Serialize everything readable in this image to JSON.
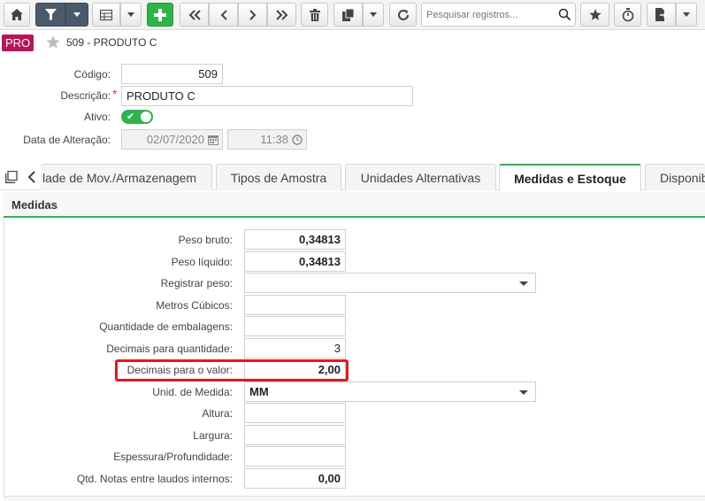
{
  "toolbar": {
    "search_placeholder": "Pesquisar registros..."
  },
  "record": {
    "badge": "PRO",
    "title": "509 - PRODUTO C"
  },
  "form": {
    "codigo_label": "Código:",
    "codigo_value": "509",
    "descricao_label": "Descrição:",
    "descricao_value": "PRODUTO C",
    "ativo_label": "Ativo:",
    "ativo_value": "✔",
    "data_label": "Data de Alteração:",
    "data_value": "02/07/2020",
    "hora_value": "11:38"
  },
  "tabs": [
    {
      "label": "lade de Mov./Armazenagem"
    },
    {
      "label": "Tipos de Amostra"
    },
    {
      "label": "Unidades Alternativas"
    },
    {
      "label": "Medidas e Estoque"
    },
    {
      "label": "Disponib"
    }
  ],
  "section": {
    "title": "Medidas"
  },
  "medidas": {
    "peso_bruto_label": "Peso bruto:",
    "peso_bruto_value": "0,34813",
    "peso_liquido_label": "Peso líquido:",
    "peso_liquido_value": "0,34813",
    "registrar_peso_label": "Registrar peso:",
    "registrar_peso_value": "",
    "metros_cubicos_label": "Metros Cúbicos:",
    "metros_cubicos_value": "",
    "qtd_embalagens_label": "Quantidade de embalagens:",
    "qtd_embalagens_value": "",
    "decimais_qtd_label": "Decimais para quantidade:",
    "decimais_qtd_value": "3",
    "decimais_valor_label": "Decimais para o valor:",
    "decimais_valor_value": "2,00",
    "unid_medida_label": "Unid. de Medida:",
    "unid_medida_value": "MM",
    "altura_label": "Altura:",
    "altura_value": "",
    "largura_label": "Largura:",
    "largura_value": "",
    "espessura_label": "Espessura/Profundidade:",
    "espessura_value": "",
    "qtd_notas_label": "Qtd. Notas entre laudos internos:",
    "qtd_notas_value": "0,00"
  },
  "colors": {
    "accent_green": "#2fb34a",
    "badge": "#b5165a",
    "highlight_red": "#e01b1b",
    "toolbar_dark": "#4b5a6a"
  }
}
